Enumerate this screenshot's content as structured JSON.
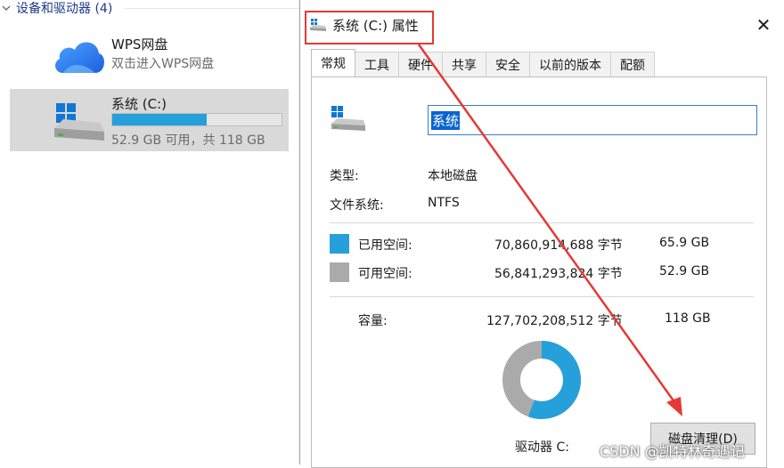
{
  "explorer": {
    "section_title": "设备和驱动器 (4)",
    "wps": {
      "name": "WPS网盘",
      "subtitle": "双击进入WPS网盘",
      "icon": "cloud-icon"
    },
    "system": {
      "name": "系统 (C:)",
      "free_text": "52.9 GB 可用，共 118 GB",
      "used_fraction": 0.558,
      "icon": "drive-icon"
    }
  },
  "dialog": {
    "title": "系统 (C:) 属性",
    "close_label": "✕",
    "tabs": [
      "常规",
      "工具",
      "硬件",
      "共享",
      "安全",
      "以前的版本",
      "配额"
    ],
    "active_tab": "常规",
    "volume_name": "系统",
    "type_label": "类型:",
    "type_value": "本地磁盘",
    "fs_label": "文件系统:",
    "fs_value": "NTFS",
    "used_label": "已用空间:",
    "used_bytes": "70,860,914,688 字节",
    "used_gb": "65.9 GB",
    "free_label": "可用空间:",
    "free_bytes": "56,841,293,824 字节",
    "free_gb": "52.9 GB",
    "capacity_label": "容量:",
    "capacity_bytes": "127,702,208,512 字节",
    "capacity_gb": "118 GB",
    "drive_label": "驱动器 C:",
    "cleanup_button": "磁盘清理(D)",
    "used_fraction": 0.555
  },
  "colors": {
    "used": "#26a0da",
    "free": "#aaaaaa",
    "annotation": "#e53935"
  },
  "watermark": "CSDN @凯特林奇遇记"
}
